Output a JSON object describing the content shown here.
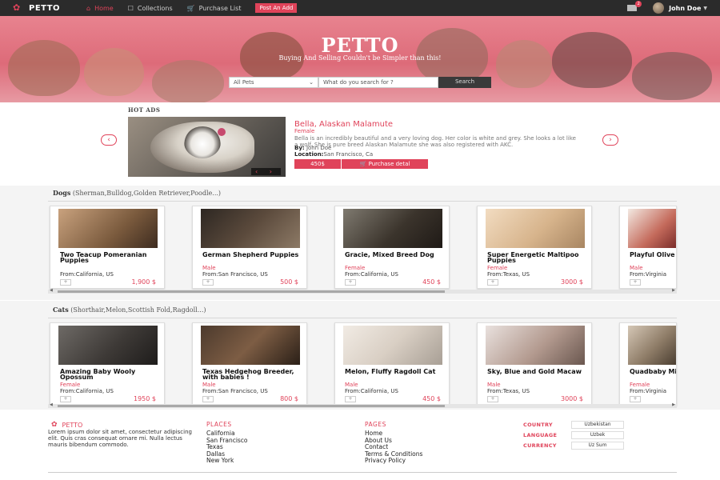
{
  "nav": {
    "brand": "PETTO",
    "home": "Home",
    "collections": "Collections",
    "purchase_list": "Purchase List",
    "post_ad": "Post An Add",
    "mail_badge": "2",
    "user": "John Doe"
  },
  "hero": {
    "title": "PETTO",
    "subtitle": "Buying And Selling Couldn't be Simpler than this!",
    "category": "All Pets",
    "search_placeholder": "What do you search for ?",
    "search_button": "Search"
  },
  "hot_ads": {
    "heading": "HOT ADS",
    "name": "Bella, Alaskan Malamute",
    "gender": "Female",
    "description": "Bella is an incredibly beautiful and a very loving dog. Her color is white and grey. She looks a lot like a wolf. She is pure breed Alaskan Malamute she was also registered with AKC.",
    "by_label": "By:",
    "by_value": "John Doe",
    "location_label": "Location:",
    "location_value": "San Francisco, Ca",
    "price": "450$",
    "buy_label": "Purchase detal"
  },
  "dogs": {
    "title": "Dogs",
    "subtitle": "(Sherman,Bulldog,Golden Retriever,Poodle...)",
    "cards": [
      {
        "title": "Two Teacup Pomeranian Puppies",
        "gender": "",
        "location": "From:California, US",
        "price": "1,900 $"
      },
      {
        "title": "German Shepherd Puppies",
        "gender": "Male",
        "location": "From:San Francisco, US",
        "price": "500 $"
      },
      {
        "title": "Gracie, Mixed Breed Dog",
        "gender": "Female",
        "location": "From:California, US",
        "price": "450 $"
      },
      {
        "title": "Super Energetic Maltipoo Puppies",
        "gender": "Female",
        "location": "From:Texas, US",
        "price": "3000 $"
      },
      {
        "title": "Playful Olive Puppy",
        "gender": "Male",
        "location": "From:Virginia",
        "price": ""
      }
    ]
  },
  "cats": {
    "title": "Cats",
    "subtitle": "(Shorthair,Melon,Scottish Fold,Ragdoll...)",
    "cards": [
      {
        "title": "Amazing Baby Wooly Opossum",
        "gender": "Female",
        "location": "From:California, US",
        "price": "1950 $"
      },
      {
        "title": "Texas Hedgehog Breeder, with babies !",
        "gender": "Male",
        "location": "From:San Francisco, US",
        "price": "800 $"
      },
      {
        "title": "Melon, Fluffy Ragdoll Cat",
        "gender": "Male",
        "location": "From:California, US",
        "price": "450 $"
      },
      {
        "title": "Sky, Blue and Gold Macaw",
        "gender": "Male",
        "location": "From:Texas, US",
        "price": "3000 $"
      },
      {
        "title": "Quadbaby Mixed Breed",
        "gender": "Female",
        "location": "From:Virginia",
        "price": ""
      }
    ]
  },
  "footer": {
    "brand": "PETTO",
    "about": "Lorem ipsum dolor sit amet, consectetur adipiscing elit. Quis cras consequat ornare mi. Nulla lectus mauris bibendum commodo.",
    "places_heading": "PLACES",
    "places": [
      "California",
      "San Francisco",
      "Texas",
      "Dallas",
      "New York"
    ],
    "pages_heading": "PAGES",
    "pages": [
      "Home",
      "About Us",
      "Contact",
      "Terms & Conditions",
      "Privacy Policy"
    ],
    "country_label": "COUNTRY",
    "country_value": "Uzbekistan",
    "language_label": "LANGUAGE",
    "language_value": "Uzbek",
    "currency_label": "CURRENCY",
    "currency_value": "Uz Sum"
  },
  "colors": {
    "accent": "#e0435a",
    "nav_bg": "#2b2b2b"
  }
}
